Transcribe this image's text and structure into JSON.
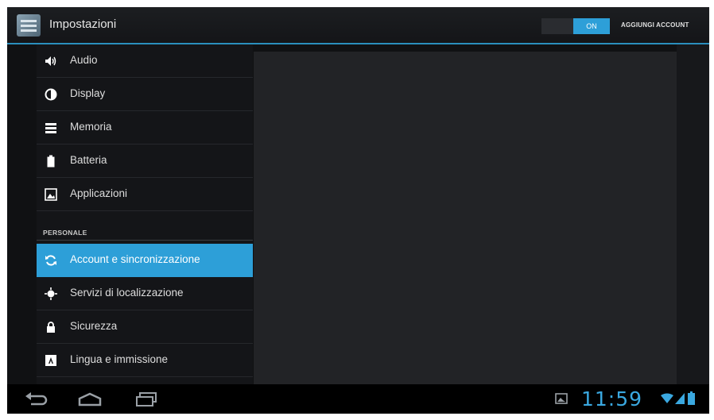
{
  "action_bar": {
    "title": "Impostazioni",
    "toggle_label": "ON",
    "add_account_label": "AGGIUNGI ACCOUNT"
  },
  "list": {
    "items_top": [
      {
        "label": "Audio",
        "icon": "speaker-icon"
      },
      {
        "label": "Display",
        "icon": "brightness-icon"
      },
      {
        "label": "Memoria",
        "icon": "storage-icon"
      },
      {
        "label": "Batteria",
        "icon": "battery-icon"
      },
      {
        "label": "Applicazioni",
        "icon": "apps-icon"
      }
    ],
    "section_header": "PERSONALE",
    "items_personal": [
      {
        "label": "Account e sincronizzazione",
        "icon": "sync-icon",
        "selected": true
      },
      {
        "label": "Servizi di localizzazione",
        "icon": "location-icon"
      },
      {
        "label": "Sicurezza",
        "icon": "lock-icon"
      },
      {
        "label": "Lingua e immissione",
        "icon": "keyboard-icon"
      }
    ]
  },
  "status_bar": {
    "time": "11:59"
  },
  "colors": {
    "accent": "#2d9fd8",
    "background": "#141518",
    "pane": "#222326"
  }
}
